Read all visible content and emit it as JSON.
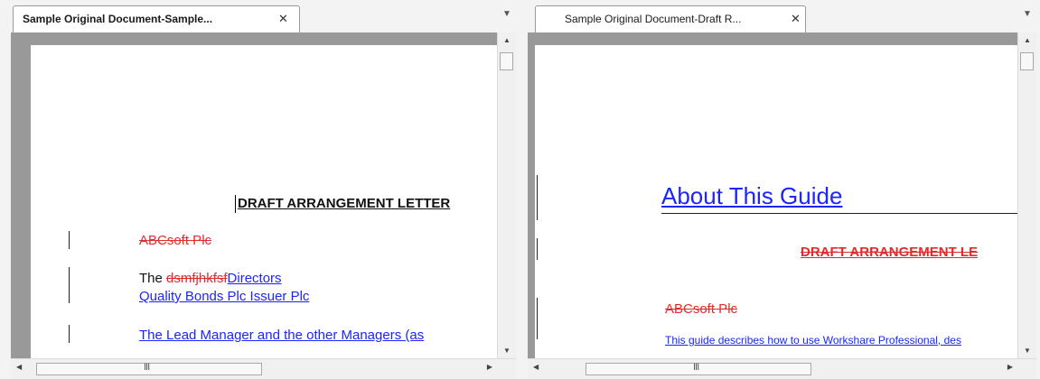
{
  "left": {
    "tab_label": "Sample Original Document-Sample...",
    "close_glyph": "✕",
    "dropdown_glyph": "▼",
    "content": {
      "heading": "DRAFT ARRANGEMENT LETTER",
      "company_deleted": "ABCsoft Plc",
      "the": "The ",
      "deleted_word": "dsmfjhkfsf",
      "inserted_word": "Directors",
      "issuer_line": "Quality Bonds Plc Issuer Plc",
      "lead_manager_line": "The Lead Manager and the other Managers (as"
    }
  },
  "right": {
    "tab_label": "Sample Original Document-Draft R...",
    "close_glyph": "✕",
    "dropdown_glyph": "▼",
    "content": {
      "title": "About This Guide",
      "heading": "DRAFT ARRANGEMENT LE",
      "company_deleted": "ABCsoft Plc",
      "guide_text": "This guide describes how to use Workshare Professional, des"
    }
  },
  "scroll": {
    "up": "▲",
    "down": "▼",
    "left": "◀",
    "right": "▶",
    "grip": "III"
  }
}
